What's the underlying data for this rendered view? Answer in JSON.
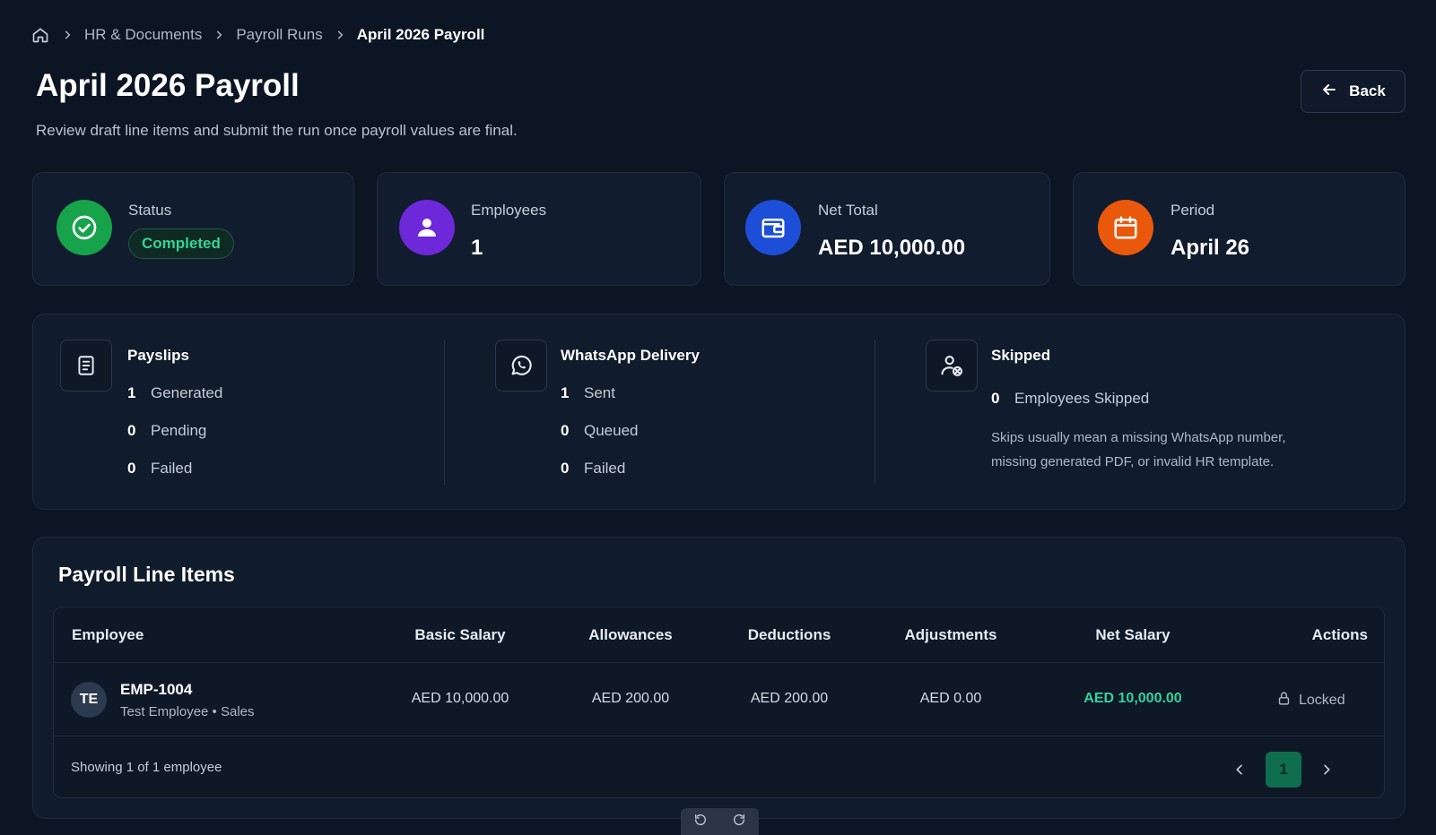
{
  "breadcrumb": {
    "items": [
      "HR & Documents",
      "Payroll Runs"
    ],
    "current": "April 2026 Payroll"
  },
  "page": {
    "title": "April 2026 Payroll",
    "subtitle": "Review draft line items and submit the run once payroll values are final.",
    "back_label": "Back"
  },
  "stats": {
    "status": {
      "label": "Status",
      "value": "Completed",
      "color": "#16a34a"
    },
    "employees": {
      "label": "Employees",
      "value": "1",
      "color": "#6d28d9"
    },
    "net_total": {
      "label": "Net Total",
      "value": "AED 10,000.00",
      "color": "#1d4ed8"
    },
    "period": {
      "label": "Period",
      "value": "April 26",
      "color": "#ea580c"
    }
  },
  "delivery": {
    "payslips": {
      "title": "Payslips",
      "rows": [
        {
          "num": "1",
          "label": "Generated"
        },
        {
          "num": "0",
          "label": "Pending"
        },
        {
          "num": "0",
          "label": "Failed"
        }
      ]
    },
    "whatsapp": {
      "title": "WhatsApp Delivery",
      "rows": [
        {
          "num": "1",
          "label": "Sent"
        },
        {
          "num": "0",
          "label": "Queued"
        },
        {
          "num": "0",
          "label": "Failed"
        }
      ]
    },
    "skipped": {
      "title": "Skipped",
      "num": "0",
      "label": "Employees Skipped",
      "note": "Skips usually mean a missing WhatsApp number, missing generated PDF, or invalid HR template."
    }
  },
  "line_items": {
    "title": "Payroll Line Items",
    "columns": [
      "Employee",
      "Basic Salary",
      "Allowances",
      "Deductions",
      "Adjustments",
      "Net Salary",
      "Actions"
    ],
    "rows": [
      {
        "initials": "TE",
        "code": "EMP-1004",
        "meta": "Test Employee • Sales",
        "basic": "AED 10,000.00",
        "allowances": "AED 200.00",
        "deductions": "AED 200.00",
        "adjustments": "AED 0.00",
        "net": "AED 10,000.00",
        "action": "Locked"
      }
    ],
    "footer": "Showing 1 of 1 employee",
    "current_page": "1"
  }
}
